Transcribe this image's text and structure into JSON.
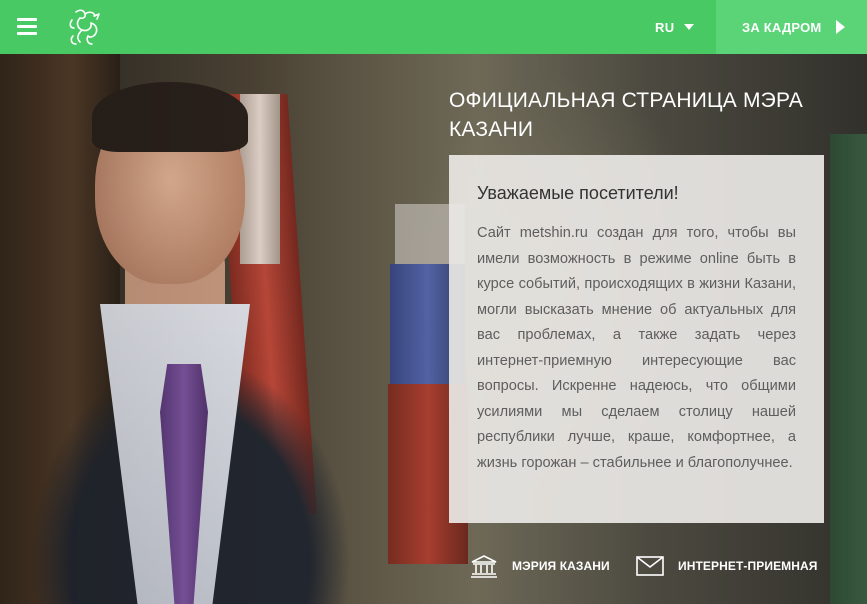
{
  "header": {
    "menu_icon": "hamburger-menu-icon",
    "logo_icon": "kazan-zilant-dragon-logo",
    "language": "RU",
    "behind_scenes_label": "ЗА КАДРОМ"
  },
  "hero": {
    "title": "ОФИЦИАЛЬНАЯ СТРАНИЦА МЭРА КАЗАНИ"
  },
  "welcome": {
    "heading": "Уважаемые посетители!",
    "body": "Сайт metshin.ru создан для того, чтобы вы имели возможность в режиме online быть в курсе событий, происходящих в жизни Казани, могли высказать мнение об актуальных для вас проблемах, а также задать через интернет-приемную интересующие вас вопросы. Искренне надеюсь, что общими усилиями мы сделаем столицу нашей республики лучше, краше, комфортнее, а жизнь горожан – стабильнее и благополучнее."
  },
  "footer_links": {
    "city_hall": {
      "label": "МЭРИЯ КАЗАНИ",
      "icon": "city-hall-building-icon"
    },
    "reception": {
      "label": "ИНТЕРНЕТ-ПРИЕМНАЯ",
      "icon": "envelope-icon"
    }
  },
  "colors": {
    "header_green": "#48c964",
    "button_green": "#5ad477",
    "card_bg": "#e9e7e4",
    "text_white": "#ffffff"
  }
}
